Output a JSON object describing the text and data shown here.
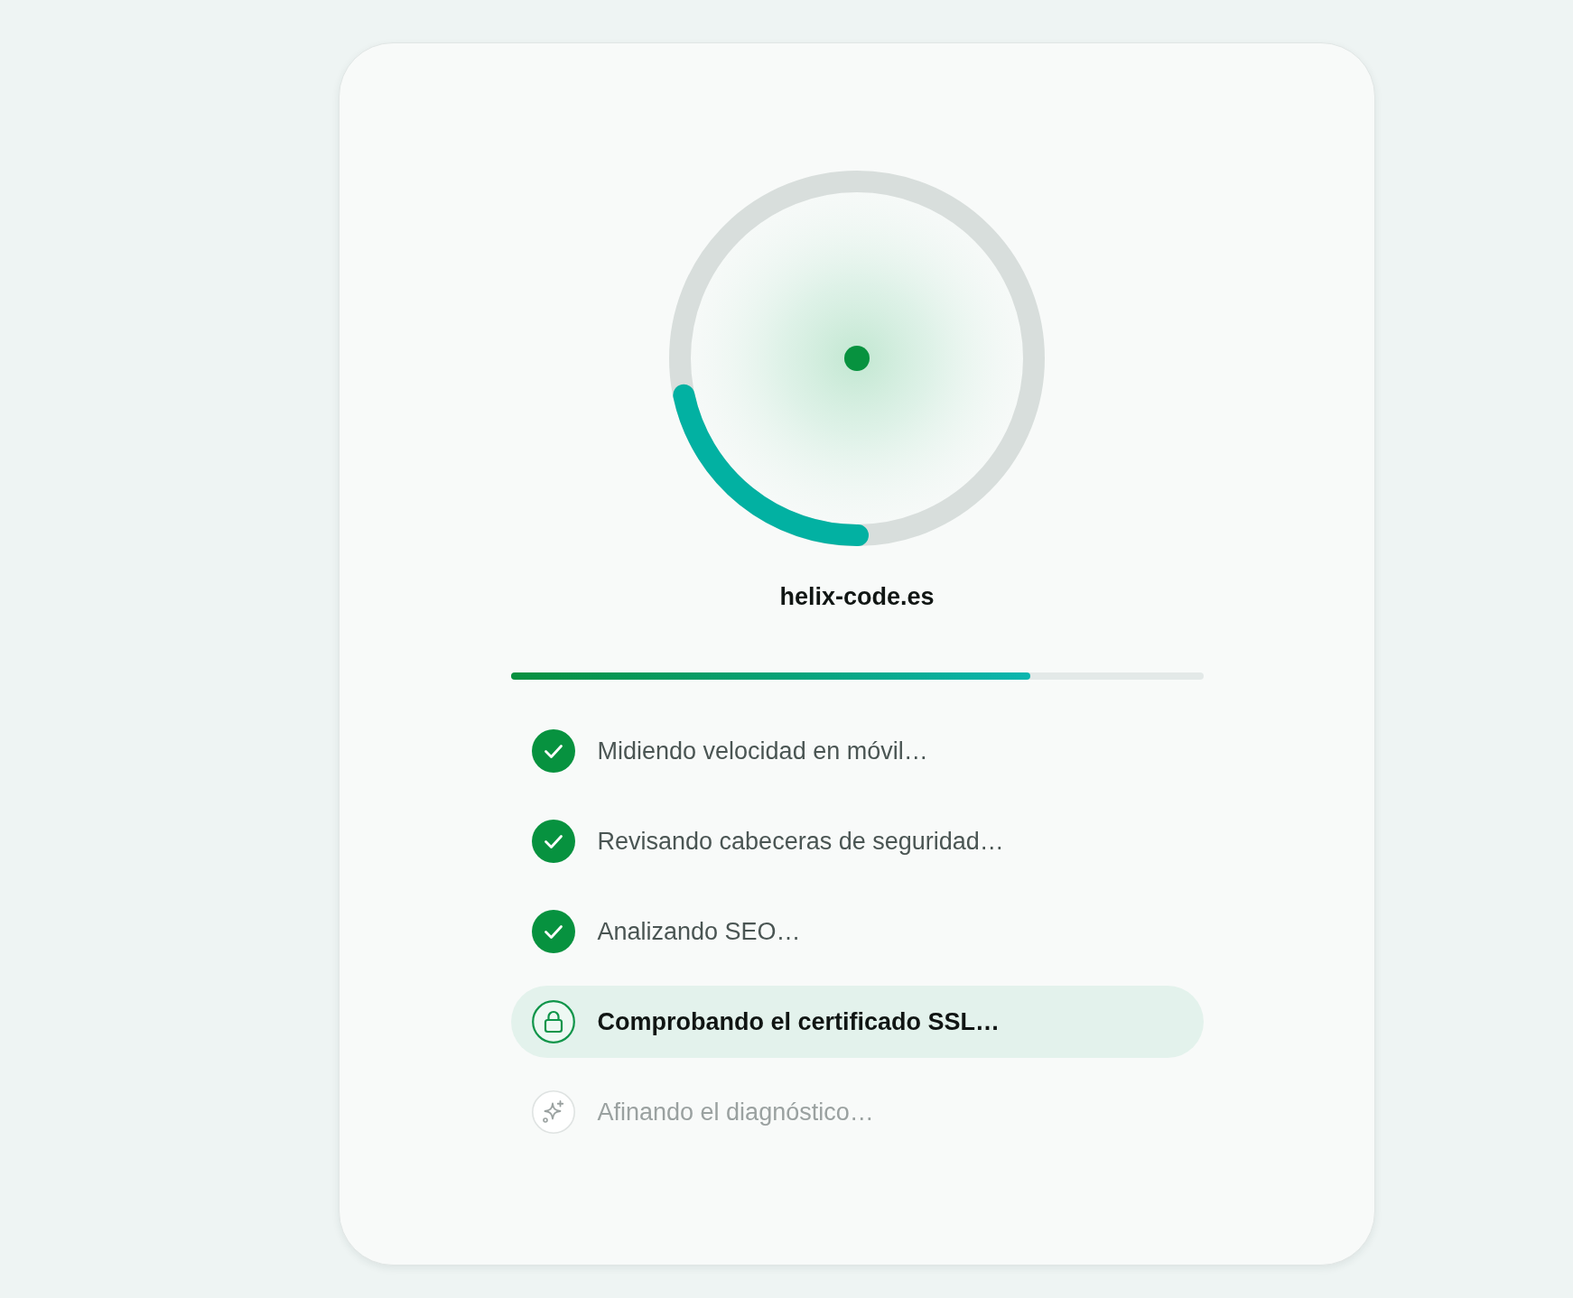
{
  "site": {
    "domain": "helix-code.es"
  },
  "progress": {
    "level": 0.75
  },
  "steps": [
    {
      "label": "Midiendo velocidad en móvil…",
      "kind": "done"
    },
    {
      "label": "Revisando cabeceras de seguridad…",
      "kind": "done"
    },
    {
      "label": "Analizando SEO…",
      "kind": "done"
    },
    {
      "label": "Comprobando el certificado SSL…",
      "kind": "active"
    },
    {
      "label": "Afinando el diagnóstico…",
      "kind": "pending"
    }
  ]
}
